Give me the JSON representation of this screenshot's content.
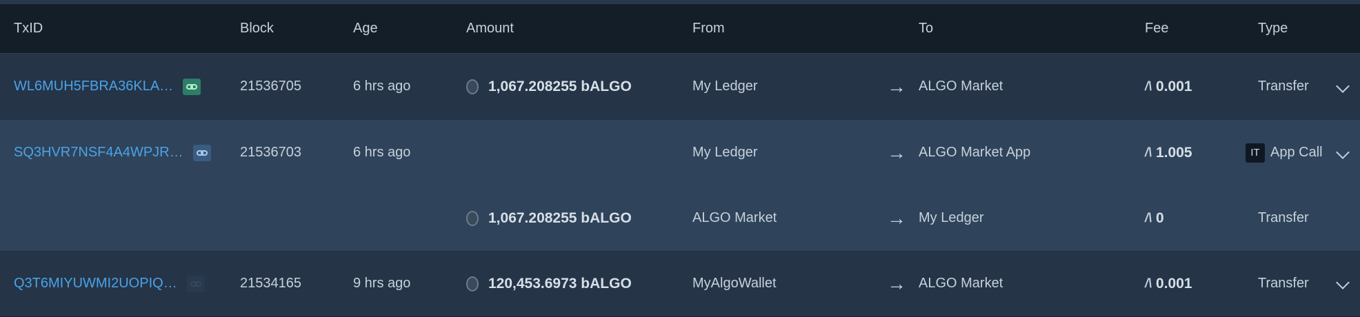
{
  "columns": {
    "txid": "TxID",
    "block": "Block",
    "age": "Age",
    "amount": "Amount",
    "from": "From",
    "to": "To",
    "fee": "Fee",
    "type": "Type"
  },
  "icons": {
    "link": "link-icon",
    "coin": "asset-coin-icon",
    "arrow": "arrow-right-icon",
    "algo": "algo-symbol-icon",
    "chevron": "chevron-down-icon"
  },
  "colors": {
    "link_text": "#4aa3e8",
    "header_bg": "#141e29",
    "row_bg": "#253447",
    "group_bg": "#2f435a",
    "badge_green": "#2e7d65"
  },
  "rows": [
    {
      "txid": "WL6MUH5FBRA36KLA…",
      "block": "21536705",
      "age": "6 hrs ago",
      "amount": "1,067.208255 bALGO",
      "from": "My Ledger",
      "arrow": "→",
      "to": "ALGO Market",
      "algo": "/\\",
      "fee": "0.001",
      "type": "Transfer"
    },
    {
      "txid": "SQ3HVR7NSF4A4WPJR…",
      "block": "21536703",
      "age": "6 hrs ago",
      "from": "My Ledger",
      "arrow": "→",
      "to": "ALGO Market App",
      "algo": "/\\",
      "fee": "1.005",
      "type_badge": "IT",
      "type": "App Call",
      "inner": {
        "amount": "1,067.208255 bALGO",
        "from": "ALGO Market",
        "arrow": "→",
        "to": "My Ledger",
        "algo": "/\\",
        "fee": "0",
        "type": "Transfer"
      }
    },
    {
      "txid": "Q3T6MIYUWMI2UOPIQ…",
      "block": "21534165",
      "age": "9 hrs ago",
      "amount": "120,453.6973 bALGO",
      "from": "MyAlgoWallet",
      "arrow": "→",
      "to": "ALGO Market",
      "algo": "/\\",
      "fee": "0.001",
      "type": "Transfer"
    }
  ]
}
